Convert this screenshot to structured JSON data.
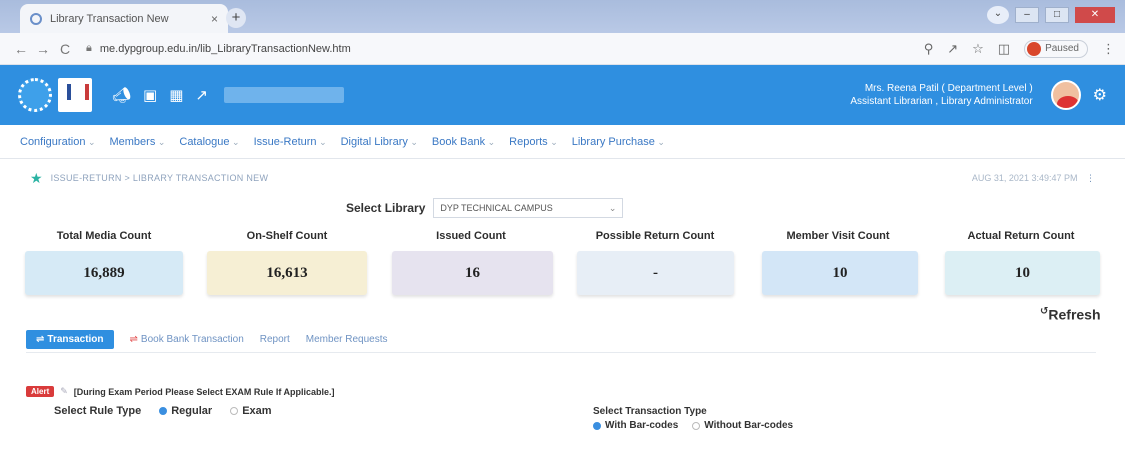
{
  "browser": {
    "tab_title": "Library Transaction New",
    "tab_close": "×",
    "new_tab": "+",
    "back": "←",
    "forward": "→",
    "reload": "C",
    "url": "me.dypgroup.edu.in/lib_LibraryTransactionNew.htm",
    "paused_label": "Paused",
    "min": "–",
    "max": "□",
    "close": "✕"
  },
  "header": {
    "user_line1": "Mrs. Reena Patil ( Department Level )",
    "user_line2": "Assistant Librarian , Library Administrator"
  },
  "menu": {
    "items": [
      "Configuration",
      "Members",
      "Catalogue",
      "Issue-Return",
      "Digital Library",
      "Book Bank",
      "Reports",
      "Library Purchase"
    ]
  },
  "breadcrumb": {
    "text": "ISSUE-RETURN > LIBRARY TRANSACTION NEW",
    "datetime": "AUG 31, 2021 3:49:47 PM"
  },
  "library": {
    "label": "Select Library",
    "value": "DYP TECHNICAL CAMPUS"
  },
  "stats": [
    {
      "label": "Total Media Count",
      "value": "16,889",
      "color": "#d6eaf6"
    },
    {
      "label": "On-Shelf Count",
      "value": "16,613",
      "color": "#f6efd4"
    },
    {
      "label": "Issued Count",
      "value": "16",
      "color": "#e6e3ef"
    },
    {
      "label": "Possible Return Count",
      "value": "-",
      "color": "#e7eef6"
    },
    {
      "label": "Member Visit Count",
      "value": "10",
      "color": "#d3e6f7"
    },
    {
      "label": "Actual Return Count",
      "value": "10",
      "color": "#dceff4"
    }
  ],
  "refresh_label": "Refresh",
  "tabs": {
    "transaction": "Transaction",
    "book_bank": "Book Bank Transaction",
    "report": "Report",
    "member_requests": "Member Requests"
  },
  "note": {
    "badge": "Alert",
    "text": "[During Exam Period Please Select EXAM Rule If Applicable.]"
  },
  "rule": {
    "label": "Select Rule Type",
    "options": [
      "Regular",
      "Exam"
    ],
    "selected": "Regular"
  },
  "transaction_type": {
    "label": "Select Transaction Type",
    "options": [
      "With Bar-codes",
      "Without Bar-codes"
    ],
    "selected": "With Bar-codes"
  }
}
